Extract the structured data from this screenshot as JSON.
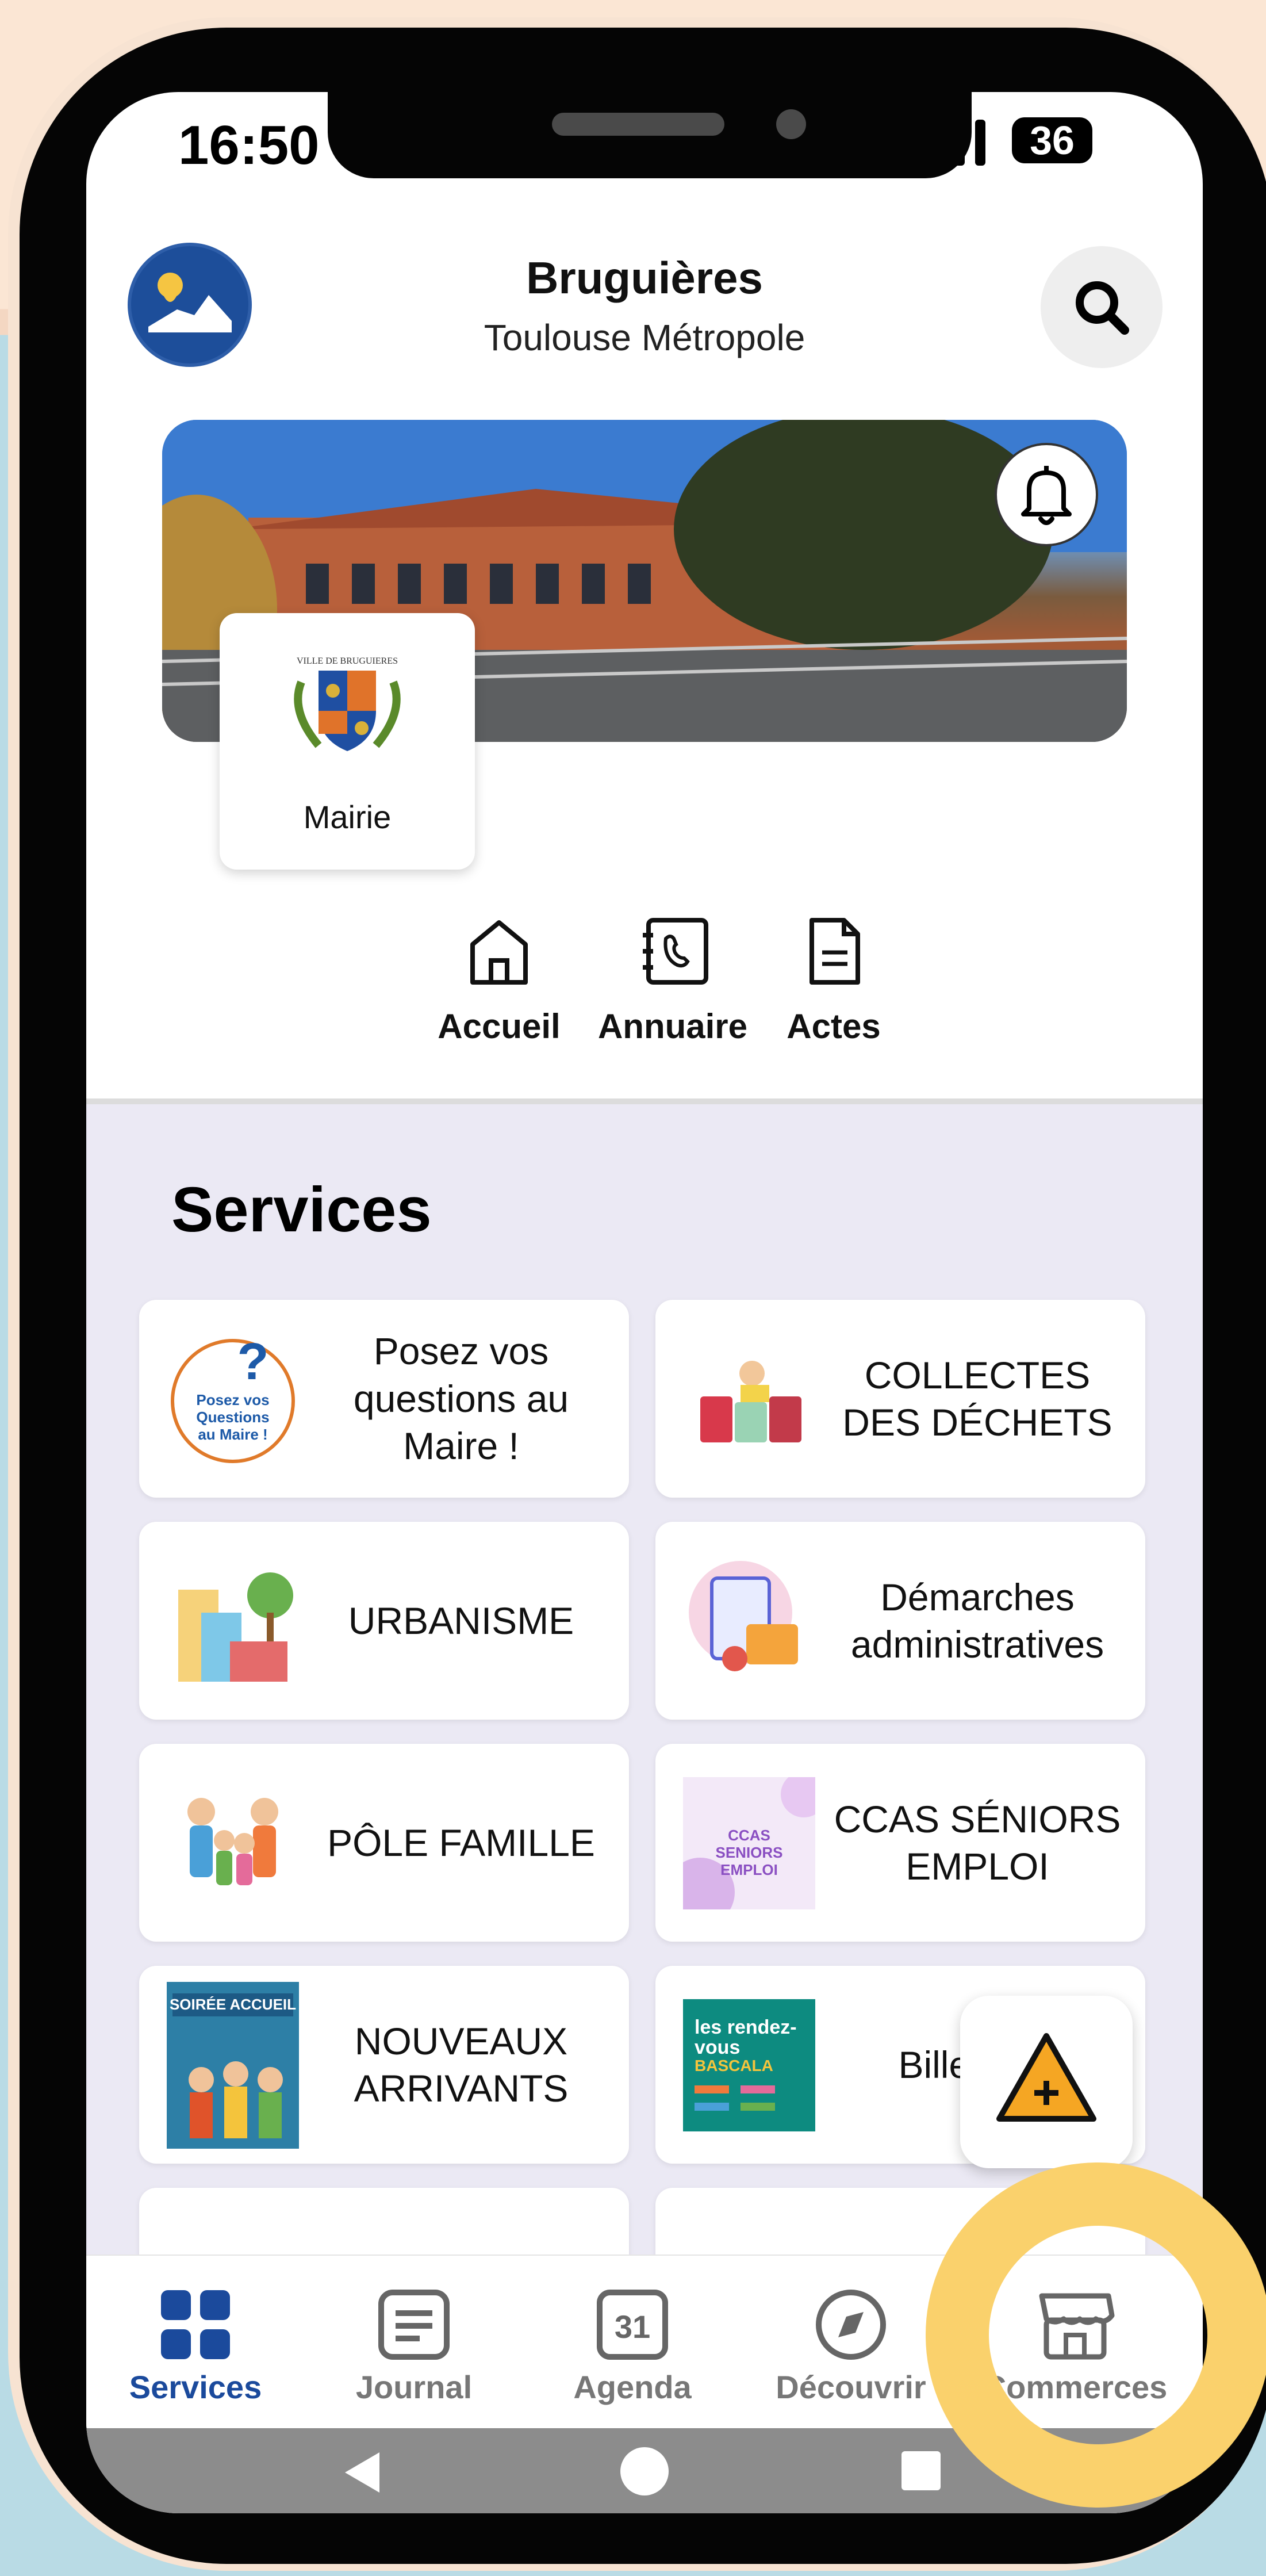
{
  "status_bar": {
    "time": "16:50",
    "battery": "36"
  },
  "header": {
    "city": "Bruguières",
    "region": "Toulouse Métropole"
  },
  "mairie_card": {
    "label": "Mairie",
    "crest_text": "VILLE DE BRUGUIERES"
  },
  "quick_nav": [
    {
      "label": "Accueil",
      "icon": "home-icon"
    },
    {
      "label": "Annuaire",
      "icon": "phone-book-icon"
    },
    {
      "label": "Actes",
      "icon": "document-icon"
    }
  ],
  "services": {
    "title": "Services",
    "items": [
      {
        "label": "Posez vos questions au Maire !",
        "thumb_text": "Posez vos Questions au Maire !"
      },
      {
        "label": "COLLECTES DES DÉCHETS"
      },
      {
        "label": "URBANISME"
      },
      {
        "label": "Démarches administratives"
      },
      {
        "label": "PÔLE FAMILLE"
      },
      {
        "label": "CCAS SÉNIORS EMPLOI",
        "thumb_text": "CCAS SENIORS EMPLOI"
      },
      {
        "label": "NOUVEAUX ARRIVANTS",
        "thumb_text": "SOIRÉE ACCUEIL"
      },
      {
        "label": "Billet Bas",
        "thumb_text": "les rendez-vous BASCALA"
      }
    ]
  },
  "tabbar": {
    "items": [
      {
        "label": "Services",
        "icon": "grid-icon",
        "active": true
      },
      {
        "label": "Journal",
        "icon": "newspaper-icon"
      },
      {
        "label": "Agenda",
        "icon": "calendar-icon",
        "day": "31"
      },
      {
        "label": "Découvrir",
        "icon": "compass-icon"
      },
      {
        "label": "Commerces",
        "icon": "store-icon"
      }
    ]
  },
  "colors": {
    "brand_blue": "#1b4a9c",
    "highlight": "#fad16c",
    "alert_orange": "#f5a623"
  }
}
